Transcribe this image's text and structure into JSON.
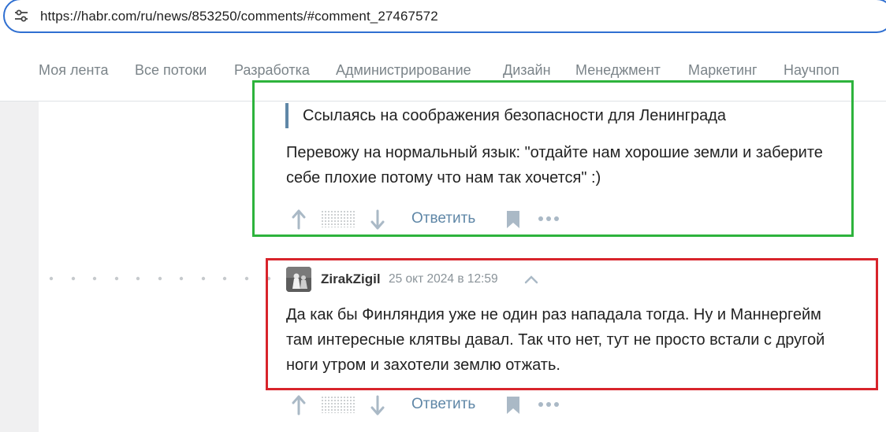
{
  "browser": {
    "url": "https://habr.com/ru/news/853250/comments/#comment_27467572",
    "site_info_icon": "tune-icon"
  },
  "nav": {
    "items": [
      "Моя лента",
      "Все потоки",
      "Разработка",
      "Администрирование",
      "Дизайн",
      "Менеджмент",
      "Маркетинг",
      "Научпоп"
    ]
  },
  "comment1": {
    "quote": "Ссылаясь на соображения безопасности для Ленинграда",
    "lines": [
      "Перевожу на нормальный язык: \"отдайте нам хорошие земли и заберите",
      "себе плохие потому что нам так хочется\" :)"
    ],
    "reply_label": "Ответить"
  },
  "comment2": {
    "username": "ZirakZigil",
    "datetime": "25 окт 2024 в 12:59",
    "lines": [
      "Да как бы Финляндия уже не один раз нападала тогда. Ну и Маннергейм",
      "там интересные клятвы давал. Так что нет, тут не просто встали с другой",
      "ноги утром и захотели землю отжать."
    ],
    "reply_label": "Ответить"
  },
  "colors": {
    "highlight_green": "#2db33c",
    "highlight_red": "#d8242b",
    "link": "#5f87a7",
    "nav_text": "#7b8489"
  }
}
